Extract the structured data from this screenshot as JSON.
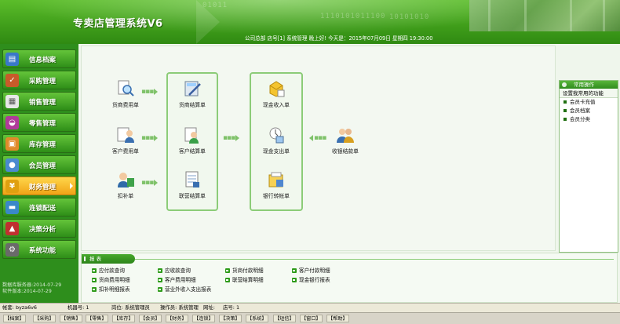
{
  "header": {
    "app_title": "专卖店管理系统V6",
    "status_line": "公司总部  店号[1]  系统管理  晚上好! 今天是：2015年07月09日  星期四   19:30:00",
    "bg_digits": [
      "01011",
      "1110101011100",
      "10101010"
    ]
  },
  "sidebar": {
    "items": [
      {
        "label": "信息档案",
        "icon": "folder-icon",
        "color": "#3a78c8"
      },
      {
        "label": "采购管理",
        "icon": "cart-icon",
        "color": "#c85a2a"
      },
      {
        "label": "销售管理",
        "icon": "document-icon",
        "color": "#e7e7e7"
      },
      {
        "label": "零售管理",
        "icon": "basket-icon",
        "color": "#b03a9a"
      },
      {
        "label": "库存管理",
        "icon": "warehouse-icon",
        "color": "#e08a2a"
      },
      {
        "label": "会员管理",
        "icon": "members-icon",
        "color": "#4a8ad0"
      },
      {
        "label": "财务管理",
        "icon": "coins-icon",
        "color": "#e0a010"
      },
      {
        "label": "连锁配送",
        "icon": "truck-icon",
        "color": "#3a88c8"
      },
      {
        "label": "决策分析",
        "icon": "chart-icon",
        "color": "#c03030"
      },
      {
        "label": "系统功能",
        "icon": "gear-icon",
        "color": "#6a6a6a"
      }
    ],
    "footer_line1": "数据库服务器:2014-07-29",
    "footer_line2": "软件版本:2014-07-29"
  },
  "flow": {
    "col1": [
      {
        "label": "货商费用单",
        "icon": "magnifier-doc-icon"
      },
      {
        "label": "客户费用单",
        "icon": "person-doc-icon"
      },
      {
        "label": "扣补单",
        "icon": "person-card-icon"
      }
    ],
    "col2": [
      {
        "label": "货商结算单",
        "icon": "calculator-pen-icon"
      },
      {
        "label": "客户结算单",
        "icon": "person-settle-icon"
      },
      {
        "label": "联营结算单",
        "icon": "joint-doc-icon"
      }
    ],
    "col3": [
      {
        "label": "现金收入单",
        "icon": "cash-in-icon"
      },
      {
        "label": "现金支出单",
        "icon": "cash-out-icon"
      },
      {
        "label": "银行转帐单",
        "icon": "bank-transfer-icon"
      }
    ],
    "col4": [
      {
        "label": "收银结款单",
        "icon": "people-cash-icon"
      }
    ]
  },
  "quick": {
    "header": "常用操作",
    "subheader": "设置我常用的功能",
    "items": [
      "会员卡充值",
      "会员档案",
      "会员分类"
    ]
  },
  "reports": {
    "tab": "报 表",
    "links": [
      "应付款查询",
      "应收款查询",
      "货商付款明细",
      "客户付款明细",
      "货商费用明细",
      "客户费用明细",
      "联营结算明细",
      "现金银行报表",
      "扣补明细报表",
      "营业外收入支出报表"
    ]
  },
  "statusbar": {
    "account": "帐套: byza6v6",
    "machine": "机器号: 1",
    "role": "岗位: 系统管理员",
    "operator": "操作员: 系统管理",
    "network": "网址:",
    "store": "店号: 1"
  },
  "taskbar": [
    "【档案】",
    "【采购】",
    "【销售】",
    "【零售】",
    "【库存】",
    "【会员】",
    "【财务】",
    "【连锁】",
    "【决策】",
    "【系统】",
    "【短信】",
    "【窗口】",
    "【帮助】"
  ]
}
